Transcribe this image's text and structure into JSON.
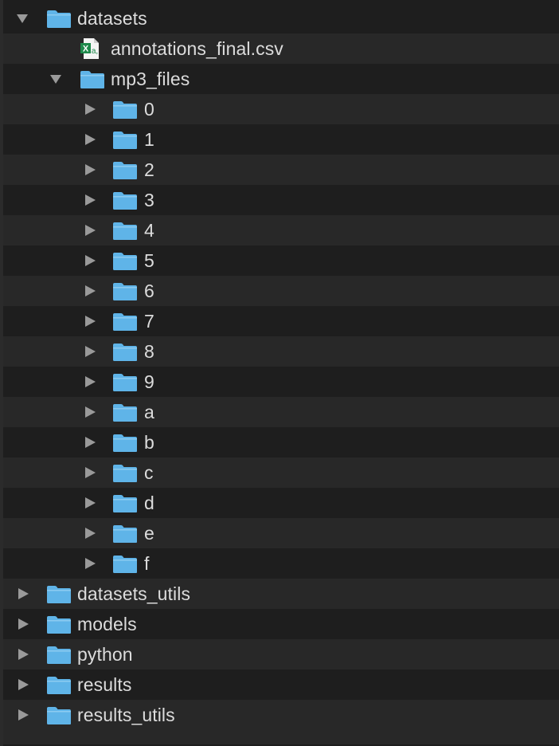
{
  "tree": {
    "colors": {
      "background": "#1e1e1e",
      "alt_row": "#282828",
      "text": "#dcdcdc",
      "folder_blue": "#5fb4e8",
      "excel_green": "#1f8a4c"
    },
    "items": [
      {
        "label": "datasets",
        "type": "folder",
        "expanded": true,
        "icon": "folder-icon"
      },
      {
        "label": "annotations_final.csv",
        "type": "file",
        "icon": "csv-file-icon"
      },
      {
        "label": "mp3_files",
        "type": "folder",
        "expanded": true,
        "icon": "folder-icon"
      },
      {
        "label": "0",
        "type": "folder",
        "expanded": false,
        "icon": "folder-icon"
      },
      {
        "label": "1",
        "type": "folder",
        "expanded": false,
        "icon": "folder-icon"
      },
      {
        "label": "2",
        "type": "folder",
        "expanded": false,
        "icon": "folder-icon"
      },
      {
        "label": "3",
        "type": "folder",
        "expanded": false,
        "icon": "folder-icon"
      },
      {
        "label": "4",
        "type": "folder",
        "expanded": false,
        "icon": "folder-icon"
      },
      {
        "label": "5",
        "type": "folder",
        "expanded": false,
        "icon": "folder-icon"
      },
      {
        "label": "6",
        "type": "folder",
        "expanded": false,
        "icon": "folder-icon"
      },
      {
        "label": "7",
        "type": "folder",
        "expanded": false,
        "icon": "folder-icon"
      },
      {
        "label": "8",
        "type": "folder",
        "expanded": false,
        "icon": "folder-icon"
      },
      {
        "label": "9",
        "type": "folder",
        "expanded": false,
        "icon": "folder-icon"
      },
      {
        "label": "a",
        "type": "folder",
        "expanded": false,
        "icon": "folder-icon"
      },
      {
        "label": "b",
        "type": "folder",
        "expanded": false,
        "icon": "folder-icon"
      },
      {
        "label": "c",
        "type": "folder",
        "expanded": false,
        "icon": "folder-icon"
      },
      {
        "label": "d",
        "type": "folder",
        "expanded": false,
        "icon": "folder-icon"
      },
      {
        "label": "e",
        "type": "folder",
        "expanded": false,
        "icon": "folder-icon"
      },
      {
        "label": "f",
        "type": "folder",
        "expanded": false,
        "icon": "folder-icon"
      },
      {
        "label": "datasets_utils",
        "type": "folder",
        "expanded": false,
        "icon": "folder-icon"
      },
      {
        "label": "models",
        "type": "folder",
        "expanded": false,
        "icon": "folder-icon"
      },
      {
        "label": "python",
        "type": "folder",
        "expanded": false,
        "icon": "folder-icon"
      },
      {
        "label": "results",
        "type": "folder",
        "expanded": false,
        "icon": "folder-icon"
      },
      {
        "label": "results_utils",
        "type": "folder",
        "expanded": false,
        "icon": "folder-icon"
      }
    ]
  }
}
